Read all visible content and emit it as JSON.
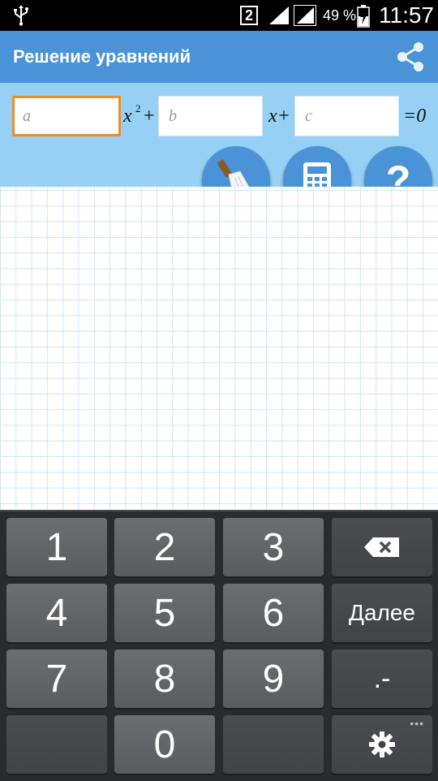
{
  "status_bar": {
    "sim_slot": "2",
    "battery_percent": "49 %",
    "time": "11:57",
    "icons": [
      "usb-icon",
      "signal-icon",
      "signal-icon",
      "battery-charging-icon"
    ]
  },
  "header": {
    "title": "Решение уравнений",
    "share_icon": "share-icon",
    "background": "#4a93d6"
  },
  "equation": {
    "a_placeholder": "a",
    "a_value": "",
    "b_placeholder": "b",
    "b_value": "",
    "c_placeholder": "c",
    "c_value": "",
    "x_squared": "x",
    "power": "2",
    "plus1": "+",
    "x_linear": "x+",
    "equals_zero": "=0",
    "focused_field": "a"
  },
  "actions": {
    "clear_icon": "broom-icon",
    "calculator_icon": "calculator-icon",
    "help_label": "?"
  },
  "keyboard": {
    "keys": {
      "k1": "1",
      "k2": "2",
      "k3": "3",
      "k4": "4",
      "k5": "5",
      "k6": "6",
      "k7": "7",
      "k8": "8",
      "k9": "9",
      "k0": "0",
      "next": "Далее",
      "dot_minus": ".-",
      "more": "•••"
    },
    "backspace_icon": "backspace-icon",
    "settings_icon": "gear-icon"
  },
  "colors": {
    "accent_blue": "#4a93d6",
    "panel_blue": "#97d0f5",
    "focus_orange": "#e88f2a"
  }
}
